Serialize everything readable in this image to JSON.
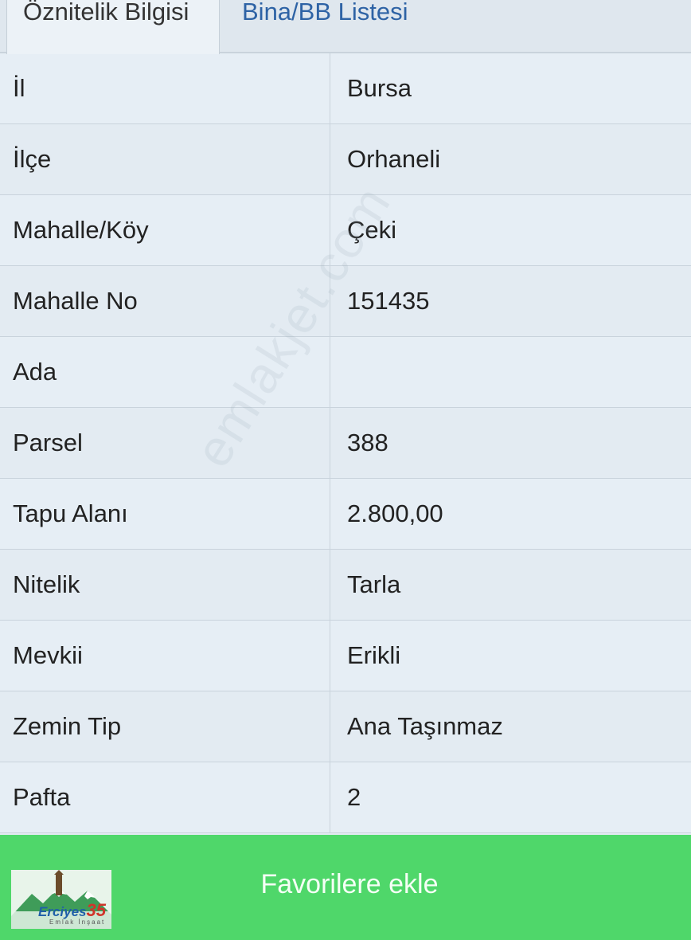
{
  "tabs": [
    {
      "label": "Öznitelik Bilgisi",
      "active": true
    },
    {
      "label": "Bina/BB Listesi",
      "active": false
    }
  ],
  "rows": [
    {
      "key": "İl",
      "value": "Bursa"
    },
    {
      "key": "İlçe",
      "value": "Orhaneli"
    },
    {
      "key": "Mahalle/Köy",
      "value": "Çeki"
    },
    {
      "key": "Mahalle No",
      "value": "151435"
    },
    {
      "key": "Ada",
      "value": ""
    },
    {
      "key": "Parsel",
      "value": "388"
    },
    {
      "key": "Tapu Alanı",
      "value": "2.800,00"
    },
    {
      "key": "Nitelik",
      "value": "Tarla"
    },
    {
      "key": "Mevkii",
      "value": "Erikli"
    },
    {
      "key": "Zemin Tip",
      "value": "Ana Taşınmaz"
    },
    {
      "key": "Pafta",
      "value": "2"
    }
  ],
  "watermark": "emlakjet.com",
  "favorite_button": {
    "label": "Favorilere ekle"
  },
  "logo": {
    "name": "Erciyes",
    "number": "35",
    "subtitle": "Emlak İnşaat"
  },
  "colors": {
    "accent_green": "#4fd76a",
    "tab_link_blue": "#2e63a5",
    "row_background": "#e3ebf2"
  }
}
